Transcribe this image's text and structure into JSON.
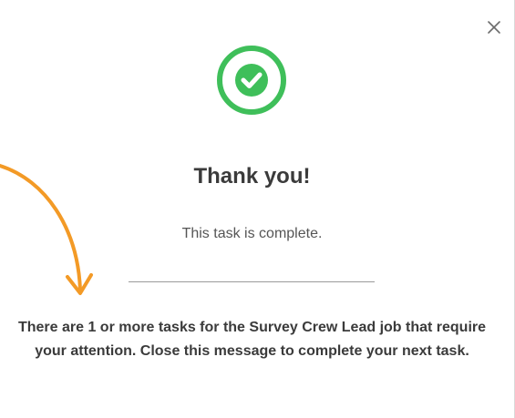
{
  "dialog": {
    "close_icon": "close-icon",
    "success_icon": "check-circle-icon",
    "arrow_icon": "curved-arrow-icon",
    "title": "Thank you!",
    "subtitle": "This task is complete.",
    "message": "There are 1 or more tasks for the Survey Crew Lead job that require your attention. Close this message to complete your next task."
  },
  "colors": {
    "success_green": "#3fbf5a",
    "arrow_orange": "#f39a26",
    "text_dark": "#3b3b3b",
    "text_muted": "#555555"
  }
}
